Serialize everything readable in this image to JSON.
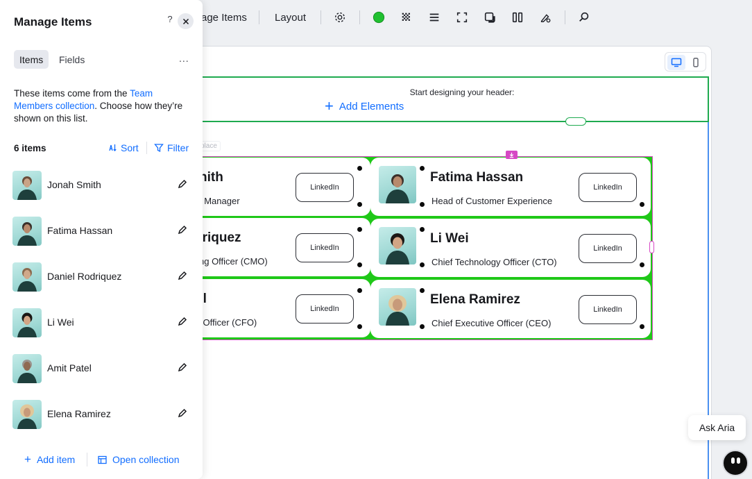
{
  "toolbar": {
    "page_name_partial": "age Items",
    "layout_label": "Layout",
    "icons": [
      "settings-gear-icon",
      "color-dot-icon",
      "pattern-icon",
      "align-icon",
      "stretch-icon",
      "shadow-icon",
      "columns-icon",
      "design-icon",
      "search-icon"
    ],
    "accent_color": "#20c030"
  },
  "panel": {
    "title": "Manage Items",
    "help_label": "?",
    "more_label": "...",
    "tabs": [
      {
        "label": "Items",
        "active": true
      },
      {
        "label": "Fields",
        "active": false
      }
    ],
    "description_prefix": "These items come from the ",
    "description_link": "Team Members collection",
    "description_suffix": ". Choose how they’re shown on this list.",
    "count_label": "6 items",
    "sort_label": "Sort",
    "filter_label": "Filter",
    "items": [
      {
        "name": "Jonah Smith"
      },
      {
        "name": "Fatima Hassan"
      },
      {
        "name": "Daniel Rodriquez"
      },
      {
        "name": "Li Wei"
      },
      {
        "name": "Amit Patel"
      },
      {
        "name": "Elena Ramirez"
      }
    ],
    "add_item_label": "Add item",
    "open_collection_label": "Open collection"
  },
  "canvas": {
    "header_hint": "Start designing your header:",
    "add_elements_label": "Add Elements",
    "place_tag": "place",
    "cards_left": [
      {
        "name_partial": "nith",
        "role_partial": "t Manager",
        "button": "LinkedIn"
      },
      {
        "name_partial": "driquez",
        "role_partial": "ng Officer (CMO)",
        "button": "LinkedIn"
      },
      {
        "name_partial": "el",
        "role_partial": "l Officer (CFO)",
        "button": "LinkedIn"
      }
    ],
    "cards_right": [
      {
        "name": "Fatima Hassan",
        "role": "Head of Customer Experience",
        "button": "LinkedIn"
      },
      {
        "name": "Li Wei",
        "role": "Chief Technology Officer (CTO)",
        "button": "LinkedIn"
      },
      {
        "name": "Elena Ramirez",
        "role": "Chief Executive Officer (CEO)",
        "button": "LinkedIn"
      }
    ]
  },
  "assistant": {
    "ask_label": "Ask Aria"
  },
  "colors": {
    "link_blue": "#116dff",
    "selection_green": "#1eaa4f",
    "repeater_fill": "#1fc818",
    "repeater_border": "#d648c4"
  }
}
